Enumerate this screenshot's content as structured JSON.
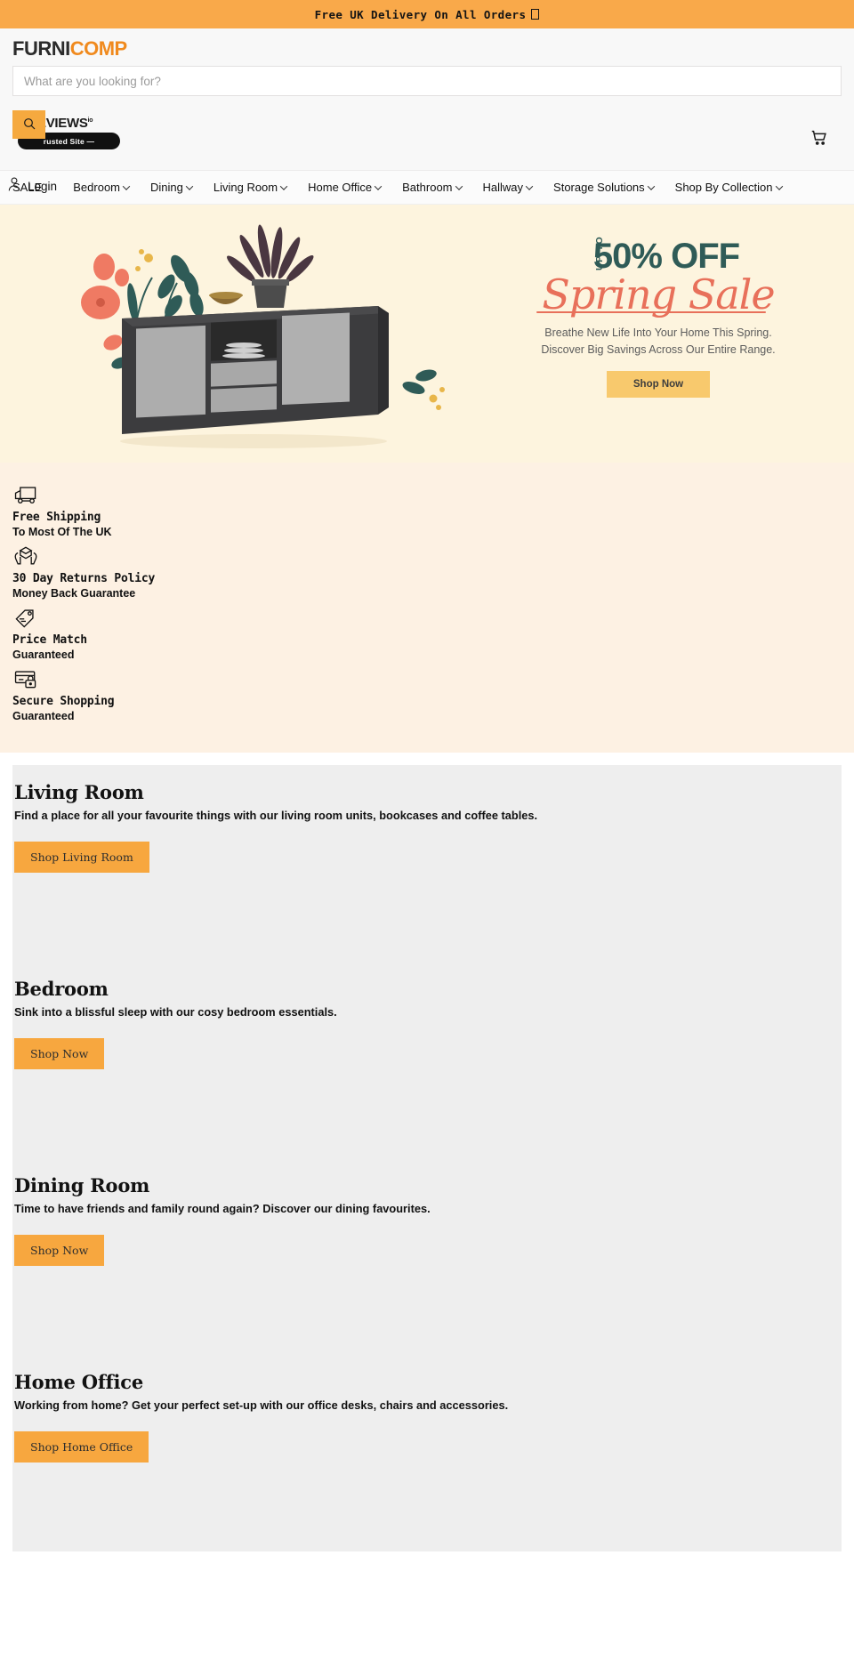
{
  "announcement": {
    "text": "Free UK Delivery On All Orders",
    "glyph_name": "missing-glyph-box"
  },
  "header": {
    "logo_part1": "FURNI",
    "logo_part2": "COMP",
    "logo_accent_color": "#f08a1e",
    "search": {
      "placeholder": "What are you looking for?",
      "value": "",
      "button_icon": "search-icon"
    },
    "reviews_badge": {
      "label": "EVIEWS",
      "suffix": "io",
      "pill_text": "rusted Site —"
    },
    "cart_icon": "shopping-cart-icon",
    "account": {
      "icon": "user-icon",
      "label": "Login"
    }
  },
  "nav": {
    "items": [
      {
        "label": "SALE",
        "has_dropdown": false
      },
      {
        "label": "Bedroom",
        "has_dropdown": true
      },
      {
        "label": "Dining",
        "has_dropdown": true
      },
      {
        "label": "Living Room",
        "has_dropdown": true
      },
      {
        "label": "Home Office",
        "has_dropdown": true
      },
      {
        "label": "Bathroom",
        "has_dropdown": true
      },
      {
        "label": "Hallway",
        "has_dropdown": true
      },
      {
        "label": "Storage Solutions",
        "has_dropdown": true
      },
      {
        "label": "Shop By Collection",
        "has_dropdown": true
      }
    ]
  },
  "hero": {
    "background_color": "#fdf4de",
    "up_to": "UP TO",
    "percent": "50% OFF",
    "script": "Spring Sale",
    "script_color": "#e8705a",
    "headline_color": "#2f5b57",
    "sub_line1": "Breathe New Life Into Your Home This Spring.",
    "sub_line2": "Discover Big Savings Across Our Entire Range.",
    "cta_label": "Shop Now",
    "cta_color": "#f8c96d"
  },
  "trust": {
    "background_color": "#fdf1e3",
    "items": [
      {
        "icon": "delivery-truck-icon",
        "title": "Free Shipping",
        "subtitle": "To Most Of The UK"
      },
      {
        "icon": "hands-box-icon",
        "title": "30 Day Returns Policy",
        "subtitle": "Money Back Guarantee"
      },
      {
        "icon": "price-tag-icon",
        "title": "Price Match",
        "subtitle": "Guaranteed"
      },
      {
        "icon": "card-lock-icon",
        "title": "Secure Shopping",
        "subtitle": "Guaranteed"
      }
    ]
  },
  "categories": [
    {
      "title": "Living Room",
      "description": "Find a place for all your favourite things with our living room units, bookcases and coffee tables.",
      "button_label": "Shop Living Room"
    },
    {
      "title": "Bedroom",
      "description": "Sink into a blissful sleep with our cosy bedroom essentials.",
      "button_label": "Shop Now"
    },
    {
      "title": "Dining Room",
      "description": "Time to have friends and family round again? Discover our dining favourites.",
      "button_label": "Shop Now"
    },
    {
      "title": "Home Office",
      "description": "Working from home? Get your perfect set-up with our office desks, chairs and accessories.",
      "button_label": "Shop Home Office"
    }
  ]
}
